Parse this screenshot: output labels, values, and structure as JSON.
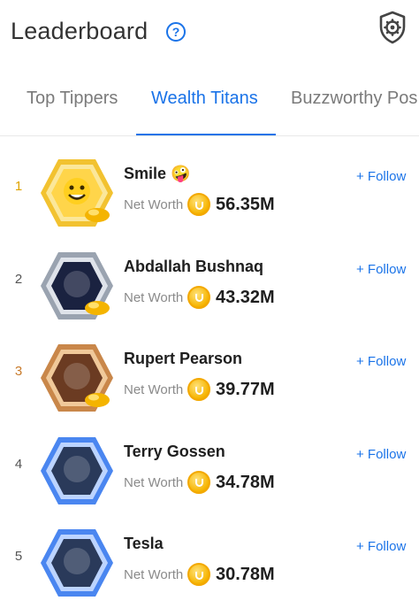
{
  "header": {
    "title": "Leaderboard",
    "help_glyph": "?",
    "help_icon": "question-circle-icon",
    "settings_icon": "shield-gear-icon"
  },
  "tabs": [
    {
      "label": "Top Tippers",
      "active": false
    },
    {
      "label": "Wealth Titans",
      "active": true
    },
    {
      "label": "Buzzworthy Pos",
      "active": false
    }
  ],
  "colors": {
    "accent": "#1a73e8",
    "rank_gold": "#e0a400",
    "rank_bronze": "#c87a2a",
    "coin": "#f6b400"
  },
  "leaderboard": [
    {
      "rank": "1",
      "name": "Smile 🤪",
      "net_worth_label": "Net Worth",
      "net_worth": "56.35M",
      "follow_label": "+ Follow",
      "frame": "gold"
    },
    {
      "rank": "2",
      "name": "Abdallah Bushnaq",
      "net_worth_label": "Net Worth",
      "net_worth": "43.32M",
      "follow_label": "+ Follow",
      "frame": "silver"
    },
    {
      "rank": "3",
      "name": "Rupert Pearson",
      "net_worth_label": "Net Worth",
      "net_worth": "39.77M",
      "follow_label": "+ Follow",
      "frame": "bronze"
    },
    {
      "rank": "4",
      "name": "Terry Gossen",
      "net_worth_label": "Net Worth",
      "net_worth": "34.78M",
      "follow_label": "+ Follow",
      "frame": "blue"
    },
    {
      "rank": "5",
      "name": "Tesla",
      "net_worth_label": "Net Worth",
      "net_worth": "30.78M",
      "follow_label": "+ Follow",
      "frame": "blue"
    }
  ]
}
